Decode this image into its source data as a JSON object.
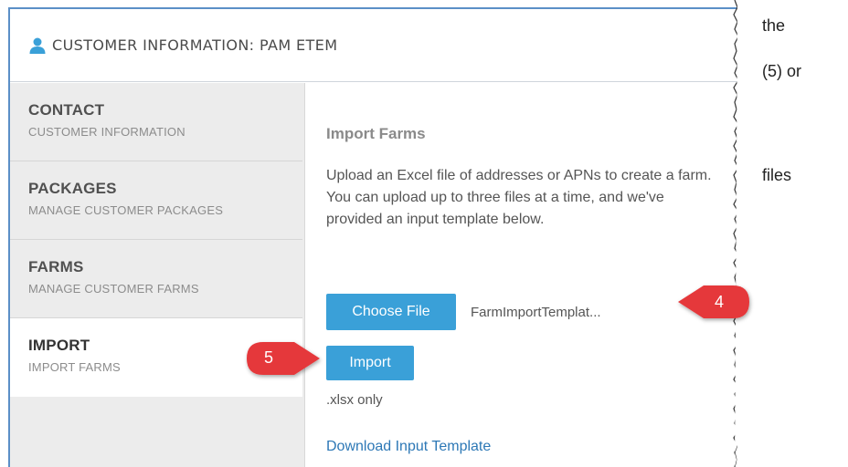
{
  "header": {
    "title": "CUSTOMER INFORMATION: PAM ETEM"
  },
  "sidebar": {
    "items": [
      {
        "title": "CONTACT",
        "subtitle": "CUSTOMER INFORMATION"
      },
      {
        "title": "PACKAGES",
        "subtitle": "MANAGE CUSTOMER PACKAGES"
      },
      {
        "title": "FARMS",
        "subtitle": "MANAGE CUSTOMER FARMS"
      },
      {
        "title": "IMPORT",
        "subtitle": "IMPORT FARMS"
      }
    ]
  },
  "main": {
    "section_title": "Import Farms",
    "description": "Upload an Excel file of addresses or APNs to create a farm. You can upload up to three files at a time, and we've provided an input template below.",
    "choose_file_label": "Choose File",
    "file_name": "FarmImportTemplat...",
    "import_label": "Import",
    "file_hint": ".xlsx only",
    "download_link": "Download Input Template"
  },
  "callouts": {
    "four": "4",
    "five": "5"
  },
  "side_text": {
    "line1": "the",
    "line2": "(5) or",
    "line3": "files"
  },
  "colors": {
    "accent": "#3aa0d8",
    "callout": "#e5383b",
    "link": "#2d78b6"
  }
}
